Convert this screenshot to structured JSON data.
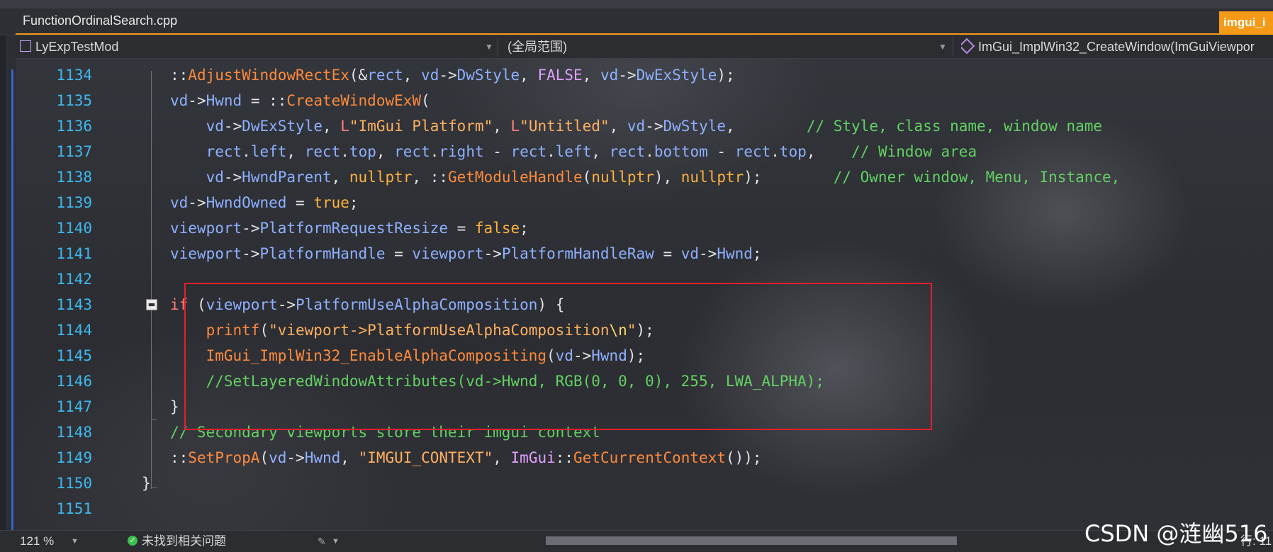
{
  "tabs": {
    "active": "FunctionOrdinalSearch.cpp",
    "right": "imgui_i"
  },
  "nav": {
    "project": "LyExpTestMod",
    "scope": "(全局范围)",
    "member": "ImGui_ImplWin32_CreateWindow(ImGuiViewpor"
  },
  "editor": {
    "line_numbers": [
      "1134",
      "1135",
      "1136",
      "1137",
      "1138",
      "1139",
      "1140",
      "1141",
      "1142",
      "1143",
      "1144",
      "1145",
      "1146",
      "1147",
      "1148",
      "1149",
      "1150",
      "1151"
    ]
  },
  "status": {
    "zoom": "121 %",
    "issues": "未找到相关问题",
    "position": "行: 11"
  },
  "watermark": "CSDN @涟幽516",
  "colors": {
    "accent": "#f49a16",
    "highlight_border": "#e0202a",
    "line_number": "#3fb8ec",
    "comment": "#63d163"
  }
}
